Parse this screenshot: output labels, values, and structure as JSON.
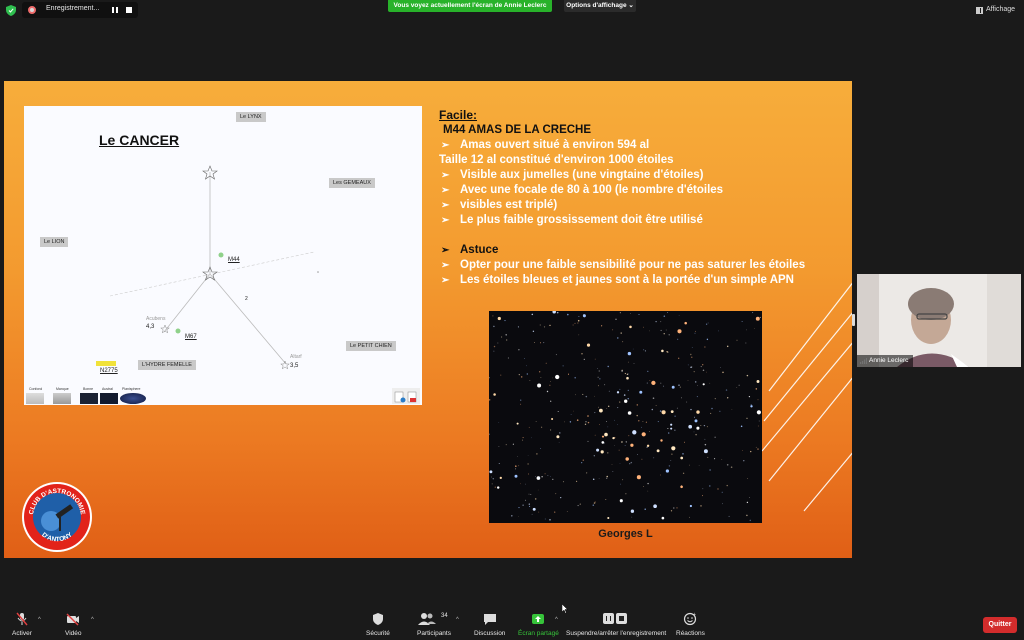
{
  "top_bar": {
    "recording_label": "Enregistrement...",
    "share_banner": "Vous voyez actuellement l'écran de Annie Leclerc",
    "view_options": "Options d'affichage",
    "view_button": "Affichage"
  },
  "slide": {
    "map": {
      "title": "Le CANCER",
      "regions": {
        "lynx": "Le LYNX",
        "gemeaux": "Les GEMEAUX",
        "lion": "Le LION",
        "petit_chien": "Le PETIT CHIEN",
        "hydre": "L'HYDRE FEMELLE"
      },
      "objects": {
        "m44": "M44",
        "m67": "M67",
        "n2775": "N2775"
      },
      "star_names": {
        "acubens": "Acubens",
        "altarf": "Altarf"
      },
      "magnitudes": {
        "acubens": "4,3",
        "altarf": "3,5",
        "marker": "2"
      },
      "thumb_labels": [
        "Confond",
        "Manque",
        "Bonne",
        "Austral",
        "Planisphere"
      ]
    },
    "text": {
      "heading": "Facile:",
      "subhead": "M44 AMAS DE LA CRECHE",
      "line1": "Amas ouvert situé à environ 594 al",
      "line2": "Taille 12 al constitué d'environ 1000 étoiles",
      "line3": "Visible aux jumelles (une vingtaine d'étoiles)",
      "line4": "Avec une focale de 80 à 100  (le nombre d'étoiles",
      "line5": "visibles est triplé)",
      "line6": "Le plus faible grossissement doit être utilisé",
      "astuce": "Astuce",
      "tip1": "Opter pour une faible sensibilité pour ne pas saturer les étoiles",
      "tip2": "Les étoiles bleues et jaunes sont à la portée d'un simple APN"
    },
    "photo_caption": "Georges L",
    "logo": {
      "top_text": "CLUB D'ASTRONOMIE",
      "bottom_text": "D'ANTONY"
    }
  },
  "video": {
    "participant_name": "Annie Leclerc"
  },
  "toolbar": {
    "mute": "Activer",
    "video": "Vidéo",
    "security": "Sécurité",
    "participants": "Participants",
    "participants_count": "34",
    "chat": "Discussion",
    "share": "Écran partagé",
    "record": "Suspendre/arrêter l'enregistrement",
    "reactions": "Réactions",
    "quit": "Quitter"
  },
  "colors": {
    "share_green": "#28b22a",
    "quit_red": "#d32c2c",
    "slide_orange": "#f39a2f"
  }
}
